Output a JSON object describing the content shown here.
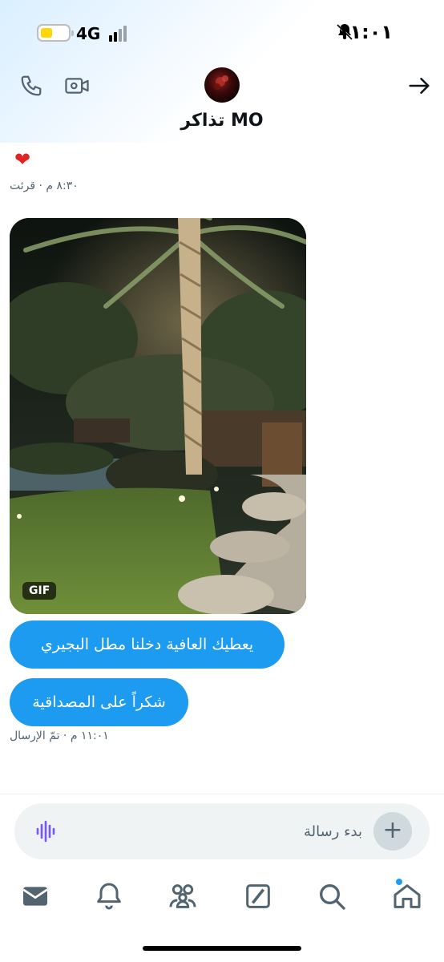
{
  "status_bar": {
    "time": "١١:٠١",
    "network": "4G",
    "battery_level": 0.4
  },
  "header": {
    "title": "تذاكر MO"
  },
  "messages": {
    "heart": "❤",
    "read_meta": "٨:٣٠ م · قرئت",
    "gif_badge": "GIF",
    "bubble_1": "يعطيك العافية دخلنا مطل البجيري",
    "bubble_2": "شكراً على المصداقية",
    "sent_meta": "١١:٠١ م · تمّ الإرسال"
  },
  "composer": {
    "placeholder": "بدء رسالة",
    "value": ""
  },
  "colors": {
    "accent": "#1d9bf0",
    "voice": "#7856ff"
  },
  "icons": {
    "header": [
      "phone-icon",
      "video-icon",
      "back-arrow-icon"
    ],
    "nav": [
      "mail-icon",
      "bell-icon",
      "communities-icon",
      "grok-icon",
      "search-icon",
      "home-icon"
    ]
  }
}
